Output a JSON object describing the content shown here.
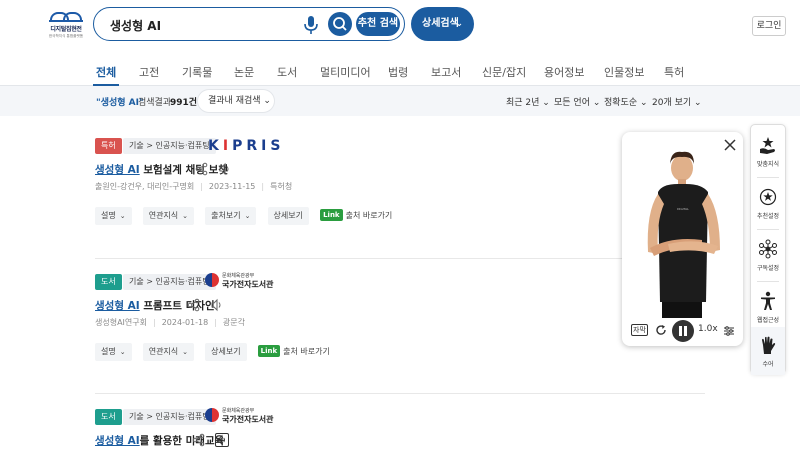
{
  "logo": {
    "line1": "디지털집현전",
    "line2": "한국학지식 통합플랫폼"
  },
  "search": {
    "query": "생성형 AI",
    "recommend_label": "추천 검색",
    "advanced_label": "상세검색"
  },
  "header": {
    "login_label": "로그인"
  },
  "tabs": [
    "전체",
    "고전",
    "기록물",
    "논문",
    "도서",
    "멀티미디어",
    "법령",
    "보고서",
    "신문/잡지",
    "용어정보",
    "인물정보",
    "특허"
  ],
  "result_bar": {
    "keyword": "\"생성형 AI\"",
    "label": "검색결과",
    "count": "991건",
    "within_label": "결과내 재검색",
    "options": [
      "최근 2년",
      "모든 언어",
      "정확도순",
      "20개 보기"
    ]
  },
  "results": [
    {
      "type": "특허",
      "category": "기술 > 인공지능·컴퓨팅",
      "source_logo": "KIPRIS",
      "title_hl": "생성형 AI",
      "title_rest": " 보험설계 채팅 보챗",
      "meta": [
        "출원인-강건우, 대리인-구명회",
        "2023-11-15",
        "특허청"
      ],
      "actions": [
        "설명",
        "연관지식",
        "출처보기",
        "상세보기",
        "출처 바로가기"
      ]
    },
    {
      "type": "도서",
      "category": "기술 > 인공지능·컴퓨팅",
      "source_sub": "문화체육관광부",
      "source_name": "국가전자도서관",
      "title_hl": "생성형 AI",
      "title_rest": " 프롬프트 디자인",
      "meta": [
        "생성형AI연구회",
        "2024-01-18",
        "광문각"
      ],
      "actions": [
        "설명",
        "연관지식",
        "상세보기",
        "출처 바로가기"
      ]
    },
    {
      "type": "도서",
      "category": "기술 > 인공지능·컴퓨팅",
      "source_sub": "문화체육관광부",
      "source_name": "국가전자도서관",
      "title_hl": "생성형 AI",
      "title_rest": "를 활용한 미래교육"
    }
  ],
  "link_tag": "Link",
  "player": {
    "caption_label": "자막",
    "speed": "1.0x"
  },
  "side_panel": [
    "맞춤지식",
    "추천설정",
    "구독설정",
    "웹접근성",
    "수어"
  ],
  "colors": {
    "primary": "#1b5ca0",
    "patent_badge": "#d9534f",
    "book_badge": "#1e9e8e",
    "link_badge": "#2a9d3f"
  }
}
